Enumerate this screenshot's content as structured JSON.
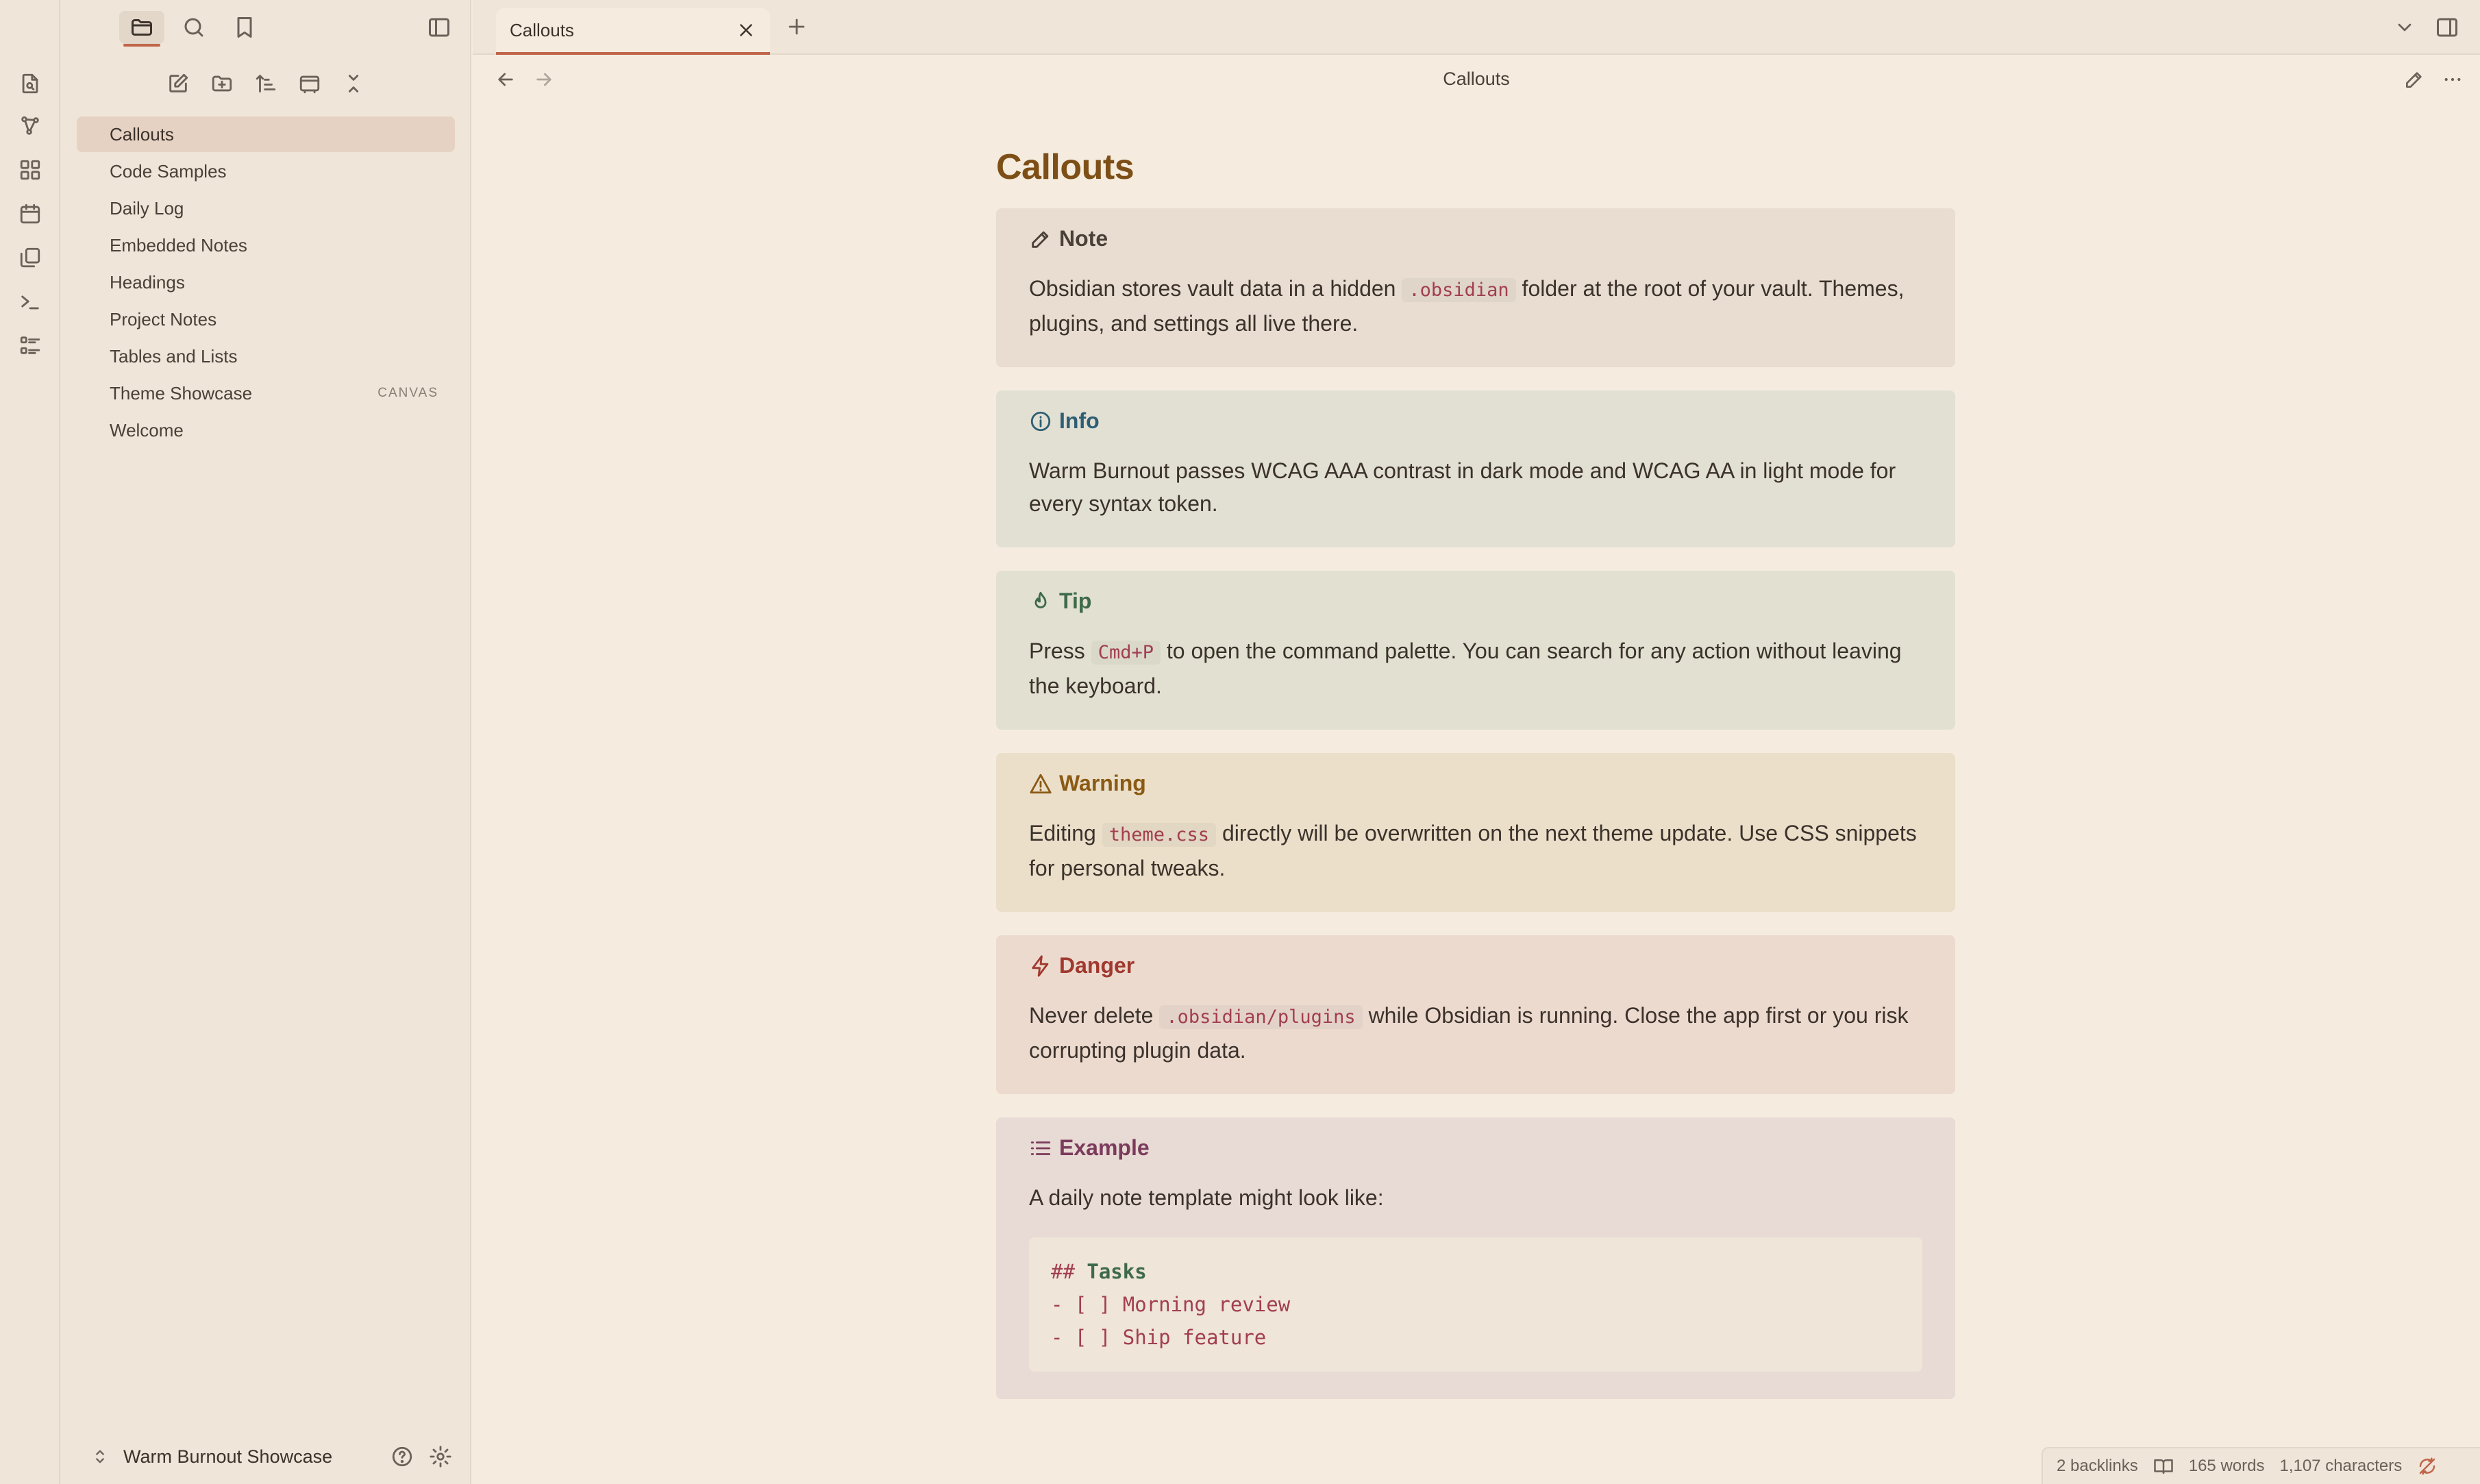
{
  "tabs": [
    {
      "label": "Callouts"
    }
  ],
  "view": {
    "title": "Callouts"
  },
  "sidebar": {
    "files": [
      {
        "label": "Callouts",
        "badge": ""
      },
      {
        "label": "Code Samples",
        "badge": ""
      },
      {
        "label": "Daily Log",
        "badge": ""
      },
      {
        "label": "Embedded Notes",
        "badge": ""
      },
      {
        "label": "Headings",
        "badge": ""
      },
      {
        "label": "Project Notes",
        "badge": ""
      },
      {
        "label": "Tables and Lists",
        "badge": ""
      },
      {
        "label": "Theme Showcase",
        "badge": "CANVAS"
      },
      {
        "label": "Welcome",
        "badge": ""
      }
    ],
    "vault_name": "Warm Burnout Showcase"
  },
  "doc": {
    "title": "Callouts",
    "callouts": {
      "note": {
        "title": "Note",
        "pre": "Obsidian stores vault data in a hidden ",
        "code": ".obsidian",
        "post": " folder at the root of your vault. Themes, plugins, and settings all live there."
      },
      "info": {
        "title": "Info",
        "text": "Warm Burnout passes WCAG AAA contrast in dark mode and WCAG AA in light mode for every syntax token."
      },
      "tip": {
        "title": "Tip",
        "pre": "Press ",
        "code": "Cmd+P",
        "post": " to open the command palette. You can search for any action without leaving the keyboard."
      },
      "warning": {
        "title": "Warning",
        "pre": "Editing ",
        "code": "theme.css",
        "post": " directly will be overwritten on the next theme update. Use CSS snippets for personal tweaks."
      },
      "danger": {
        "title": "Danger",
        "pre": "Never delete ",
        "code": ".obsidian/plugins",
        "post": " while Obsidian is running. Close the app first or you risk corrupting plugin data."
      },
      "example": {
        "title": "Example",
        "text": "A daily note template might look like:",
        "code_lines": {
          "heading_hash": "##",
          "heading_text": "Tasks",
          "line2": "- [ ] Morning review",
          "line3": "- [ ] Ship feature"
        }
      }
    }
  },
  "status": {
    "backlinks": "2 backlinks",
    "words": "165 words",
    "characters": "1,107 characters"
  },
  "colors": {
    "accent": "#c0654a",
    "background": "#f5ecdf",
    "title": "#7d4f16"
  }
}
